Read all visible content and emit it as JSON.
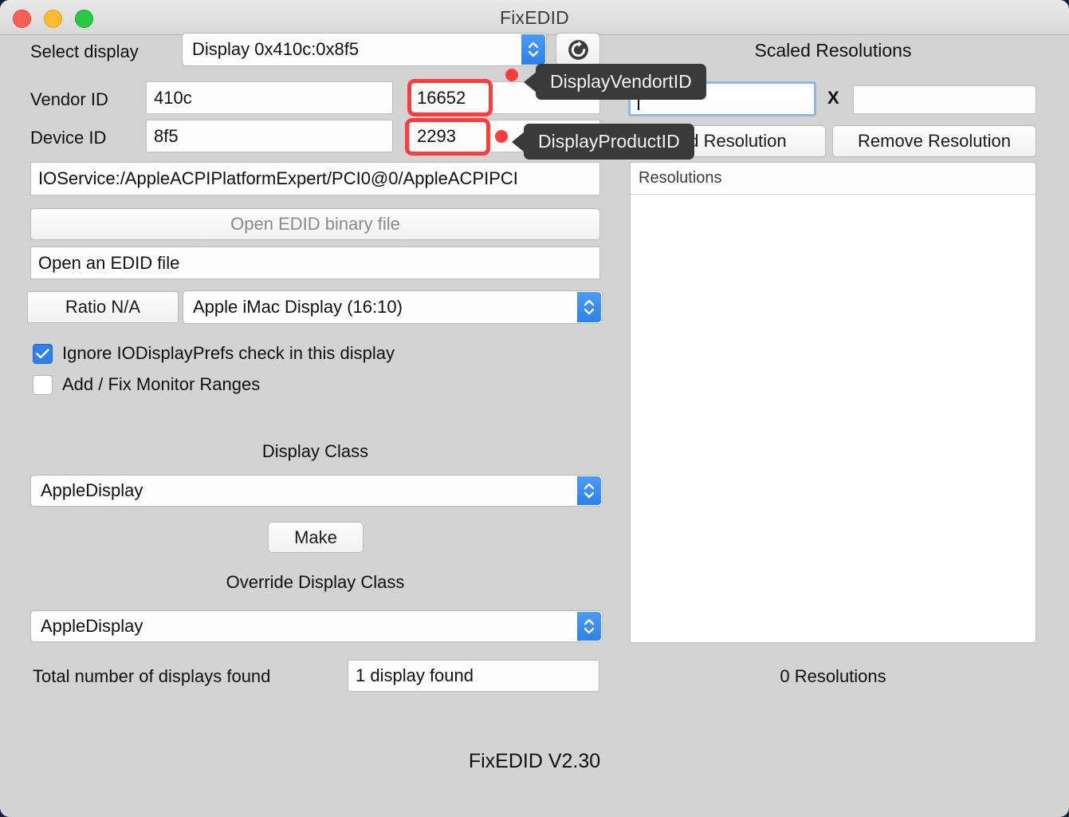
{
  "window": {
    "title": "FixEDID",
    "traffic_lights": [
      "close",
      "minimize",
      "maximize"
    ]
  },
  "left_panel": {
    "select_display_label": "Select display",
    "select_display_value": "Display 0x410c:0x8f5",
    "refresh_icon": "refresh-icon",
    "vendor_id_label": "Vendor ID",
    "vendor_id_hex": "410c",
    "vendor_id_dec": "16652",
    "device_id_label": "Device ID",
    "device_id_hex": "8f5",
    "device_id_dec": "2293",
    "io_service_path": "IOService:/AppleACPIPlatformExpert/PCI0@0/AppleACPIPCI",
    "open_edid_binary_button": "Open EDID binary file",
    "open_edid_file_value": "Open an EDID file",
    "ratio_button": "Ratio N/A",
    "display_model_value": "Apple iMac Display (16:10)",
    "checkbox_ignore_label": "Ignore IODisplayPrefs check in this display",
    "checkbox_ignore_checked": true,
    "checkbox_ranges_label": "Add / Fix Monitor Ranges",
    "checkbox_ranges_checked": false,
    "display_class_title": "Display Class",
    "display_class_value": "AppleDisplay",
    "make_button": "Make",
    "override_display_class_title": "Override Display Class",
    "override_display_class_value": "AppleDisplay",
    "total_displays_label": "Total number of displays found",
    "total_displays_value": "1 display found"
  },
  "right_panel": {
    "title": "Scaled Resolutions",
    "width_value": "",
    "x_separator": "X",
    "height_value": "",
    "add_resolution_button": "Add Resolution",
    "remove_resolution_button": "Remove Resolution",
    "list_header": "Resolutions",
    "list_rows": [],
    "resolution_count": "0 Resolutions"
  },
  "tooltips": [
    {
      "id": "vendor",
      "text": "DisplayVendortID"
    },
    {
      "id": "product",
      "text": "DisplayProductID"
    }
  ],
  "annotations": {
    "highlight_color": "#ff3b3b",
    "boxes": [
      "vendor-id-decimal",
      "device-id-decimal"
    ],
    "dots": 2
  },
  "footer": {
    "version": "FixEDID V2.30"
  }
}
